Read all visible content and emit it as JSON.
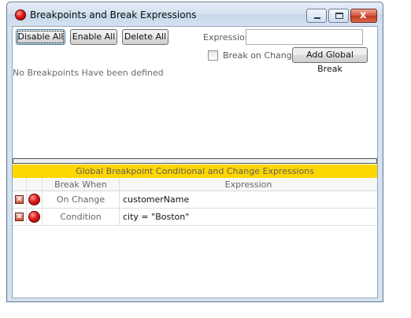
{
  "window": {
    "title": "Breakpoints and Break Expressions",
    "close_glyph": "x"
  },
  "toolbar": {
    "disable_all": "Disable All",
    "enable_all": "Enable All",
    "delete_all": "Delete All",
    "expression_label": "Expression",
    "expression_value": "",
    "break_on_change_label": "Break on Change",
    "break_on_change_checked": false,
    "add_global_break": "Add Global Break"
  },
  "breakpoints": {
    "empty_message": "No Breakpoints Have been defined"
  },
  "global_expressions": {
    "banner": "Global Breakpoint Conditional and Change Expressions",
    "columns": [
      "Break When",
      "Expression"
    ],
    "rows": [
      {
        "break_when": "On Change",
        "expression": "customerName",
        "delete_glyph": "x"
      },
      {
        "break_when": "Condition",
        "expression": "city = \"Boston\"",
        "delete_glyph": "x"
      }
    ]
  },
  "colors": {
    "banner": "#ffd700",
    "breakpoint_red": "#e11b1b"
  },
  "icons": {
    "app": "breakpoint-red-icon",
    "row_delete": "delete-icon",
    "row_breakpoint": "breakpoint-red-icon"
  }
}
